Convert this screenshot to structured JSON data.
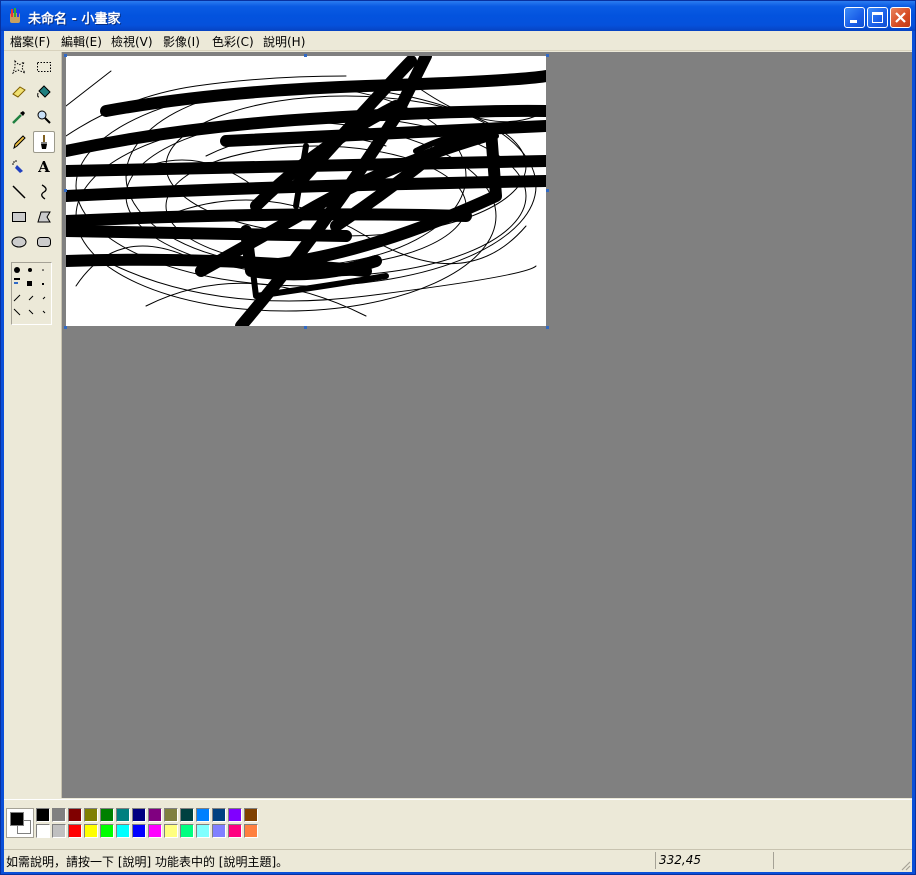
{
  "window": {
    "title": "未命名 - 小畫家"
  },
  "menu": {
    "items": [
      "檔案(F)",
      "編輯(E)",
      "檢視(V)",
      "影像(I)",
      "色彩(C)",
      "說明(H)"
    ]
  },
  "toolbox": {
    "tools": [
      {
        "name": "free-form-select-icon"
      },
      {
        "name": "rect-select-icon"
      },
      {
        "name": "eraser-icon"
      },
      {
        "name": "fill-icon"
      },
      {
        "name": "color-picker-icon"
      },
      {
        "name": "magnifier-icon"
      },
      {
        "name": "pencil-icon"
      },
      {
        "name": "brush-icon"
      },
      {
        "name": "airbrush-icon"
      },
      {
        "name": "text-icon",
        "glyph": "A"
      },
      {
        "name": "line-icon"
      },
      {
        "name": "curve-icon"
      },
      {
        "name": "rectangle-icon"
      },
      {
        "name": "polygon-icon"
      },
      {
        "name": "ellipse-icon"
      },
      {
        "name": "rounded-rect-icon"
      }
    ],
    "active_tool": "brush-icon"
  },
  "palette": {
    "foreground": "#000000",
    "background": "#ffffff",
    "row1": [
      "#000000",
      "#808080",
      "#800000",
      "#808000",
      "#008000",
      "#008080",
      "#000080",
      "#800080",
      "#808040",
      "#004040",
      "#0080ff",
      "#004080",
      "#8000ff",
      "#804000"
    ],
    "row2": [
      "#ffffff",
      "#c0c0c0",
      "#ff0000",
      "#ffff00",
      "#00ff00",
      "#00ffff",
      "#0000ff",
      "#ff00ff",
      "#ffff80",
      "#00ff80",
      "#80ffff",
      "#8080ff",
      "#ff0080",
      "#ff8040"
    ]
  },
  "status": {
    "help_text": "如需說明，請按一下 [說明] 功能表中的 [說明主題]。",
    "coordinates": "332,45"
  }
}
